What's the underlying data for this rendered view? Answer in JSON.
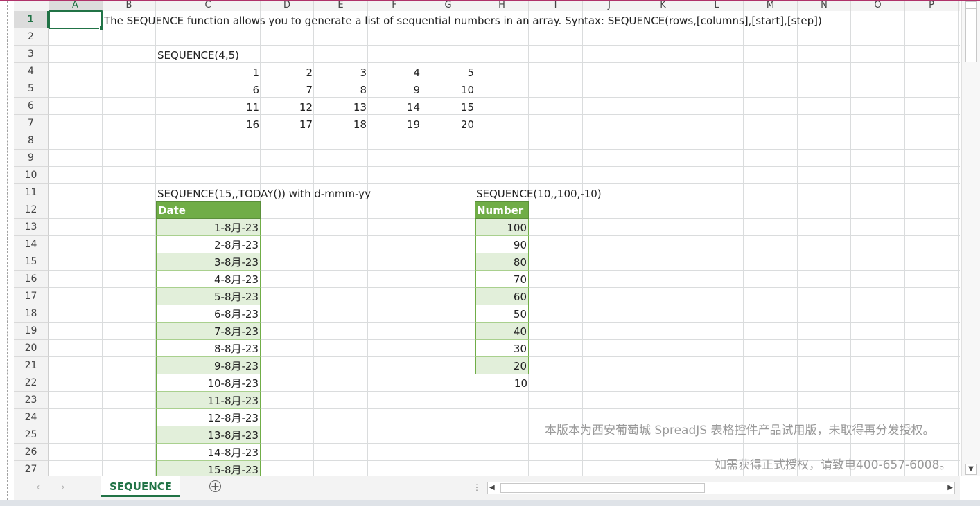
{
  "columns": [
    "A",
    "B",
    "C",
    "D",
    "E",
    "F",
    "G",
    "H",
    "I",
    "J",
    "K",
    "L",
    "M",
    "N",
    "O",
    "P"
  ],
  "rows": [
    1,
    2,
    3,
    4,
    5,
    6,
    7,
    8,
    9,
    10,
    11,
    12,
    13,
    14,
    15,
    16,
    17,
    18,
    19,
    20,
    21,
    22,
    23,
    24,
    25,
    26,
    27
  ],
  "active_cell": "A1",
  "cells": {
    "b1": "The SEQUENCE function allows you to generate a list of sequential numbers in an array. Syntax: SEQUENCE(rows,[columns],[start],[step])",
    "c3": "SEQUENCE(4,5)",
    "c11": "SEQUENCE(15,,TODAY()) with d-mmm-yy",
    "h11": "SEQUENCE(10,,100,-10)"
  },
  "seq_matrix": [
    [
      "1",
      "2",
      "3",
      "4",
      "5"
    ],
    [
      "6",
      "7",
      "8",
      "9",
      "10"
    ],
    [
      "11",
      "12",
      "13",
      "14",
      "15"
    ],
    [
      "16",
      "17",
      "18",
      "19",
      "20"
    ]
  ],
  "date_table": {
    "header": "Date",
    "values": [
      "1-8月-23",
      "2-8月-23",
      "3-8月-23",
      "4-8月-23",
      "5-8月-23",
      "6-8月-23",
      "7-8月-23",
      "8-8月-23",
      "9-8月-23",
      "10-8月-23",
      "11-8月-23",
      "12-8月-23",
      "13-8月-23",
      "14-8月-23",
      "15-8月-23"
    ]
  },
  "number_table": {
    "header": "Number",
    "values": [
      "100",
      "90",
      "80",
      "70",
      "60",
      "50",
      "40",
      "30",
      "20",
      "10"
    ]
  },
  "watermark": {
    "line1": "本版本为西安葡萄城 SpreadJS 表格控件产品试用版，未取得再分发授权。",
    "line2": "如需获得正式授权，请致电400-657-6008。"
  },
  "sheet_tab": "SEQUENCE",
  "icons": {
    "add_sheet": "plus-circle-icon",
    "nav_prev": "chevron-left-icon",
    "nav_next": "chevron-right-icon"
  },
  "colors": {
    "accent": "#217346",
    "table_header": "#70ad47",
    "table_band": "#e2efda"
  }
}
